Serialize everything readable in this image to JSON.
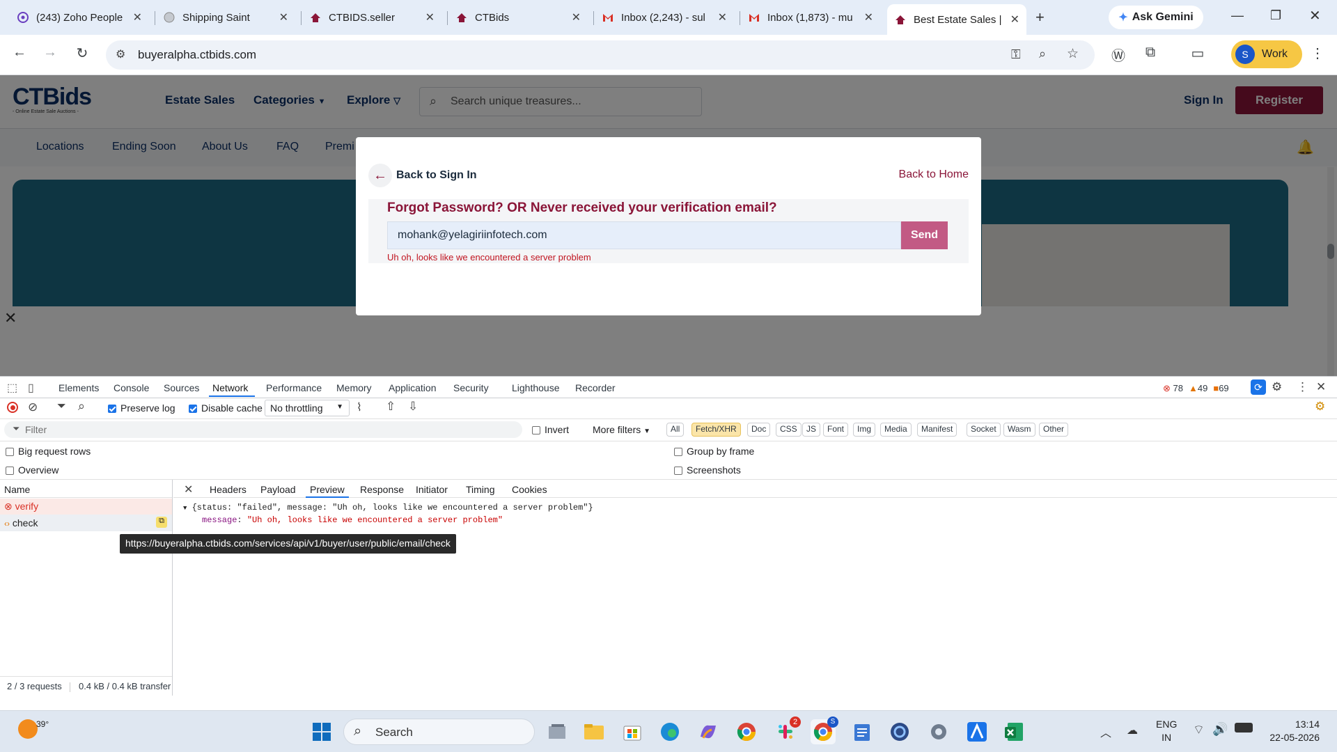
{
  "browser": {
    "tabs": [
      {
        "title": "(243) Zoho People",
        "icon": "zoho-icon"
      },
      {
        "title": "Shipping Saint",
        "icon": "globe-icon"
      },
      {
        "title": "CTBIDS.seller",
        "icon": "ctbids-icon"
      },
      {
        "title": "CTBids",
        "icon": "ctbids-icon"
      },
      {
        "title": "Inbox (2,243) - sul",
        "icon": "gmail-icon"
      },
      {
        "title": "Inbox (1,873) - mu",
        "icon": "gmail-icon"
      },
      {
        "title": "Best Estate Sales |",
        "icon": "ctbids-icon"
      }
    ],
    "ask_gemini": "Ask Gemini",
    "url": "buyeralpha.ctbids.com",
    "profile_initial": "S",
    "profile_label": "Work"
  },
  "site": {
    "logo_text": "CTBids",
    "logo_tagline": "- Online Estate Sale Auctions -",
    "nav": {
      "estate_sales": "Estate Sales",
      "categories": "Categories",
      "explore": "Explore"
    },
    "search_placeholder": "Search unique treasures...",
    "sign_in": "Sign In",
    "register": "Register",
    "subnav": [
      "Locations",
      "Ending Soon",
      "About Us",
      "FAQ",
      "Premi"
    ],
    "brand_color": "#8a1538"
  },
  "modal": {
    "back_to_sign_in": "Back to Sign In",
    "back_to_home": "Back to Home",
    "heading": "Forgot Password? OR Never received your verification email?",
    "email_value": "mohank@yelagiriinfotech.com",
    "send": "Send",
    "error": "Uh oh, looks like we encountered a server problem"
  },
  "devtools": {
    "tabs": [
      "Elements",
      "Console",
      "Sources",
      "Network",
      "Performance",
      "Memory",
      "Application",
      "Security",
      "Lighthouse",
      "Recorder"
    ],
    "active_tab": "Network",
    "errors": "78",
    "warnings": "49",
    "issues": "69",
    "preserve_log": "Preserve log",
    "disable_cache": "Disable cache",
    "throttling": "No throttling",
    "filter_placeholder": "Filter",
    "invert": "Invert",
    "more_filters": "More filters",
    "type_filters": [
      "All",
      "Fetch/XHR",
      "Doc",
      "CSS",
      "JS",
      "Font",
      "Img",
      "Media",
      "Manifest",
      "Socket",
      "Wasm",
      "Other"
    ],
    "active_type": "Fetch/XHR",
    "big_request_rows": "Big request rows",
    "group_by_frame": "Group by frame",
    "overview": "Overview",
    "screenshots": "Screenshots",
    "name_header": "Name",
    "requests": [
      {
        "name": "verify",
        "status": "error"
      },
      {
        "name": "check",
        "status": "xhr"
      }
    ],
    "detail_tabs": [
      "Headers",
      "Payload",
      "Preview",
      "Response",
      "Initiator",
      "Timing",
      "Cookies"
    ],
    "active_detail": "Preview",
    "preview_line1": "{status: \"failed\", message: \"Uh oh, looks like we encountered a server problem\"}",
    "preview_key": "message",
    "preview_value": "\"Uh oh, looks like we encountered a server problem\"",
    "tooltip_url": "https://buyeralpha.ctbids.com/services/api/v1/buyer/user/public/email/check",
    "status_requests": "2 / 3 requests",
    "status_transfer": "0.4 kB / 0.4 kB transfer"
  },
  "taskbar": {
    "weather": "39°",
    "search": "Search",
    "lang_top": "ENG",
    "lang_bottom": "IN",
    "time": "13:14",
    "date": "22-05-2026",
    "slack_badge": "2",
    "chrome_badge": "S"
  }
}
